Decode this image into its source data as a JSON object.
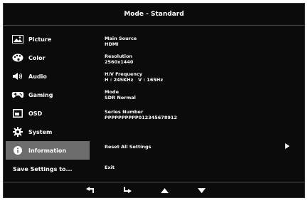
{
  "header": {
    "title": "Mode - Standard"
  },
  "sidebar": {
    "items": [
      {
        "label": "Picture",
        "icon": "picture-icon",
        "selected": false
      },
      {
        "label": "Color",
        "icon": "palette-icon",
        "selected": false
      },
      {
        "label": "Audio",
        "icon": "speaker-icon",
        "selected": false
      },
      {
        "label": "Gaming",
        "icon": "gamepad-icon",
        "selected": false
      },
      {
        "label": "OSD",
        "icon": "osd-icon",
        "selected": false
      },
      {
        "label": "System",
        "icon": "gear-icon",
        "selected": false
      },
      {
        "label": "Information",
        "icon": "info-icon",
        "selected": true
      }
    ],
    "save_label": "Save Settings to..."
  },
  "info": {
    "main_source_label": "Main Source",
    "main_source_value": "HDMI",
    "resolution_label": "Resolution",
    "resolution_value": "2560x1440",
    "hv_label": "H/V Frequency",
    "hv_value": "H : 245KHz   V : 165Hz",
    "mode_label": "Mode",
    "mode_value": "SDR Normal",
    "serial_label": "Series Number",
    "serial_value": "PPPPPPPPPP012345678912"
  },
  "actions": {
    "reset_label": "Reset All Settings",
    "exit_label": "Exit"
  },
  "footer": {
    "icons": [
      "back-icon",
      "enter-icon",
      "up-arrow-icon",
      "down-arrow-icon"
    ]
  },
  "colors": {
    "background": "#0b0b0b",
    "selected": "#6d6d6d",
    "text": "#ffffff"
  }
}
